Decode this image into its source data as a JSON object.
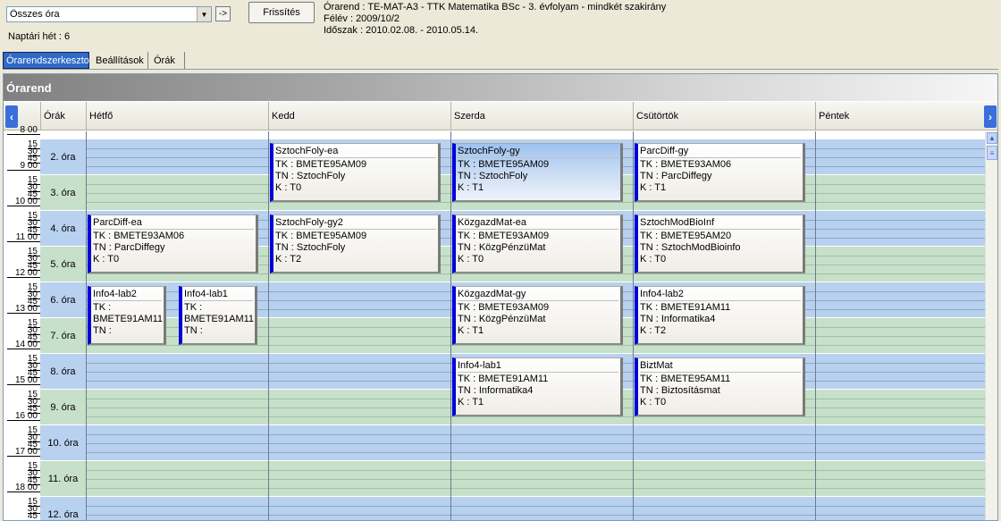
{
  "filter": {
    "selected": "Összes óra",
    "go_label": "->"
  },
  "refresh_label": "Frissítés",
  "week_label": "Naptári hét : 6",
  "info": {
    "line1": "Órarend : TE-MAT-A3 - TTK Matematika BSc - 3. évfolyam - mindkét szakirány",
    "line2": "Félév : 2009/10/2",
    "line3": "Időszak : 2010.02.08. - 2010.05.14."
  },
  "tabs": [
    "Órarendszerkeszto",
    "Beállítások",
    "Órák"
  ],
  "panel_title": "Órarend",
  "columns": {
    "hours": "Órák",
    "days": [
      "Hétfő",
      "Kedd",
      "Szerda",
      "Csütörtök",
      "Péntek"
    ]
  },
  "hours": [
    "2. óra",
    "3. óra",
    "4. óra",
    "5. óra",
    "6. óra",
    "7. óra",
    "8. óra",
    "9. óra",
    "10. óra",
    "11. óra",
    "12. óra"
  ],
  "time_labels": [
    {
      "hour": "8 00",
      "q": [
        "15",
        "30",
        "45"
      ]
    },
    {
      "hour": "9 00",
      "q": [
        "15",
        "30",
        "45"
      ]
    },
    {
      "hour": "10 00",
      "q": [
        "15",
        "30",
        "45"
      ]
    },
    {
      "hour": "11 00",
      "q": [
        "15",
        "30",
        "45"
      ]
    },
    {
      "hour": "12 00",
      "q": [
        "15",
        "30",
        "45"
      ]
    },
    {
      "hour": "13 00",
      "q": [
        "15",
        "30",
        "45"
      ]
    },
    {
      "hour": "14 00",
      "q": [
        "15",
        "30",
        "45"
      ]
    },
    {
      "hour": "15 00",
      "q": [
        "15",
        "30",
        "45"
      ]
    },
    {
      "hour": "16 00",
      "q": [
        "15",
        "30",
        "45"
      ]
    },
    {
      "hour": "17 00",
      "q": [
        "15",
        "30",
        "45"
      ]
    },
    {
      "hour": "18 00",
      "q": [
        "15",
        "30",
        "45"
      ]
    }
  ],
  "cards": [
    {
      "title": "SztochFoly-ea",
      "tk": "TK : BMETE95AM09",
      "tn": "TN : SztochFoly",
      "k": "K : T0"
    },
    {
      "title": "SztochFoly-gy",
      "tk": "TK : BMETE95AM09",
      "tn": "TN : SztochFoly",
      "k": "K : T1"
    },
    {
      "title": "ParcDiff-gy",
      "tk": "TK : BMETE93AM06",
      "tn": "TN : ParcDiffegy",
      "k": "K : T1"
    },
    {
      "title": "ParcDiff-ea",
      "tk": "TK : BMETE93AM06",
      "tn": "TN : ParcDiffegy",
      "k": "K : T0"
    },
    {
      "title": "SztochFoly-gy2",
      "tk": "TK : BMETE95AM09",
      "tn": "TN : SztochFoly",
      "k": "K : T2"
    },
    {
      "title": "KözgazdMat-ea",
      "tk": "TK : BMETE93AM09",
      "tn": "TN : KözgPénzüMat",
      "k": "K : T0"
    },
    {
      "title": "SztochModBioInf",
      "tk": "TK : BMETE95AM20",
      "tn": "TN : SztochModBioinfo",
      "k": "K : T0"
    },
    {
      "title": "Info4-lab2",
      "tk": "TK :",
      "tn": "BMETE91AM11",
      "k": "TN :"
    },
    {
      "title": "Info4-lab1",
      "tk": "TK :",
      "tn": "BMETE91AM11",
      "k": "TN :"
    },
    {
      "title": "KözgazdMat-gy",
      "tk": "TK : BMETE93AM09",
      "tn": "TN : KözgPénzüMat",
      "k": "K : T1"
    },
    {
      "title": "Info4-lab2",
      "tk": "TK : BMETE91AM11",
      "tn": "TN : Informatika4",
      "k": "K : T2"
    },
    {
      "title": "Info4-lab1",
      "tk": "TK : BMETE91AM11",
      "tn": "TN : Informatika4",
      "k": "K : T1"
    },
    {
      "title": "BiztMat",
      "tk": "TK : BMETE95AM11",
      "tn": "TN : Biztosításmat",
      "k": "K : T0"
    }
  ],
  "icons": {
    "prev": "chevron-left-icon",
    "next": "chevron-right-icon",
    "dropdown": "chevron-down-icon"
  }
}
